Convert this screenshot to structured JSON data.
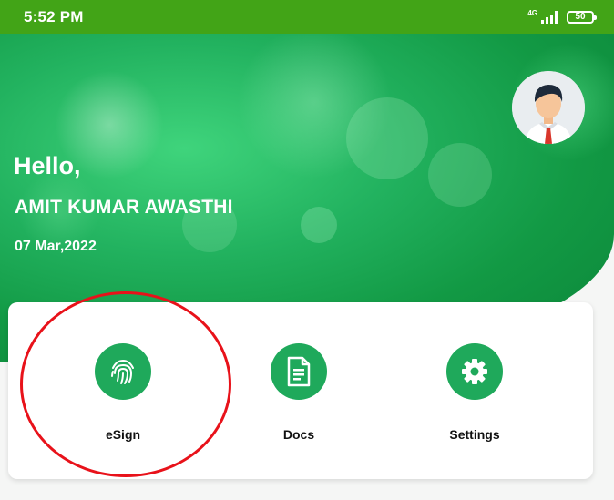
{
  "status_bar": {
    "time": "5:52 PM",
    "network": "4G",
    "battery": "50"
  },
  "header": {
    "greeting": "Hello,",
    "user_name": "AMIT KUMAR AWASTHI",
    "date": "07 Mar,2022",
    "avatar_icon": "avatar-icon"
  },
  "actions": [
    {
      "label": "eSign",
      "icon": "fingerprint-icon"
    },
    {
      "label": "Docs",
      "icon": "document-icon"
    },
    {
      "label": "Settings",
      "icon": "gear-icon"
    }
  ],
  "colors": {
    "status_bar": "#42a417",
    "accent": "#1fa95b",
    "highlight": "#e8121a"
  }
}
